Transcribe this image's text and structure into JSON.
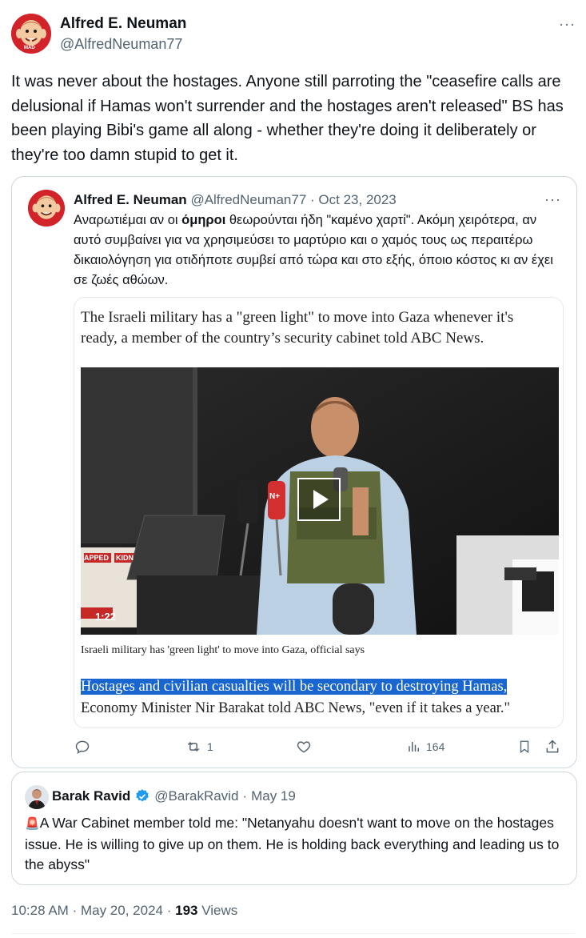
{
  "tweet": {
    "author_name": "Alfred E. Neuman",
    "handle": "@AlfredNeuman77",
    "avatar_text": "MAD",
    "more": "···",
    "text": "It was never about the hostages. Anyone still parroting the \"ceasefire calls are delusional if Hamas won't surrender and the hostages aren't released\" BS has been playing Bibi's game all along - whether they're doing it deliberately or they're too damn stupid to get it.",
    "time": "10:28 AM",
    "date": "May 20, 2024",
    "views_count": "193",
    "views_label": "Views"
  },
  "quoted": {
    "author_name": "Alfred E. Neuman",
    "handle": "@AlfredNeuman77",
    "date": "Oct 23, 2023",
    "more": "···",
    "text_before": "Αναρωτιέμαι αν οι ",
    "text_bold": "όμηροι",
    "text_after": "  θεωρούνται ήδη \"καμένο χαρτί\".  Ακόμη χειρότερα, αν αυτό συμβαίνει για να χρησιμεύσει το μαρτύριο και ο χαμός τους ως περαιτέρω δικαιολόγηση για οτιδήποτε συμβεί από τώρα και στο εξής, όποιο κόστος κι αν έχει σε ζωές αθώων.",
    "article": {
      "headline": "The Israeli military has a \"green light\" to move into Gaza whenever it's ready, a member of the country’s security cabinet told ABC News.",
      "video_duration": "1:22",
      "caption": "Israeli military has 'green light' to move into Gaza, official says",
      "highlight": "Hostages and civilian casualties will be secondary to destroying Hamas,",
      "continuation": "Economy Minister Nir Barakat told ABC News, \"even if it takes a year.\"",
      "sign_text_1": "APPED",
      "sign_text_2": "KIDN",
      "mic_logo": "N+"
    },
    "actions": {
      "reply": "",
      "retweets": "1",
      "likes": "",
      "views": "164"
    }
  },
  "second_quote": {
    "author_name": "Barak Ravid",
    "handle": "@BarakRavid",
    "date": "May 19",
    "emoji": "🚨",
    "text": "A War Cabinet member told me: \"Netanyahu doesn't want to move on the hostages issue. He is willing to give up on them. He is holding back everything and leading us to the abyss\""
  },
  "colors": {
    "text": "#0f1419",
    "secondary": "#536471",
    "border": "#cfd9de",
    "verified": "#1d9bf0",
    "highlight": "#1a66d1"
  }
}
